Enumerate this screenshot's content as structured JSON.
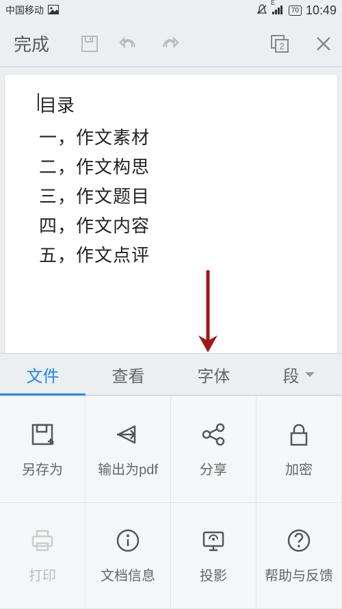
{
  "statusBar": {
    "carrier": "中国移动",
    "time": "10:49",
    "battery": "70"
  },
  "topToolbar": {
    "done": "完成",
    "pageIndicator": "2"
  },
  "document": {
    "title": "目录",
    "lines": {
      "l1": "一，作文素材",
      "l2": "二，作文构思",
      "l3": "三，作文题目",
      "l4": "四，作文内容",
      "l5": "五，作文点评"
    }
  },
  "tabs": {
    "t1": "文件",
    "t2": "查看",
    "t3": "字体",
    "t4": "段"
  },
  "grid": {
    "saveAs": "另存为",
    "exportPdf": "输出为pdf",
    "share": "分享",
    "encrypt": "加密",
    "print": "打印",
    "docInfo": "文档信息",
    "project": "投影",
    "help": "帮助与反馈"
  }
}
